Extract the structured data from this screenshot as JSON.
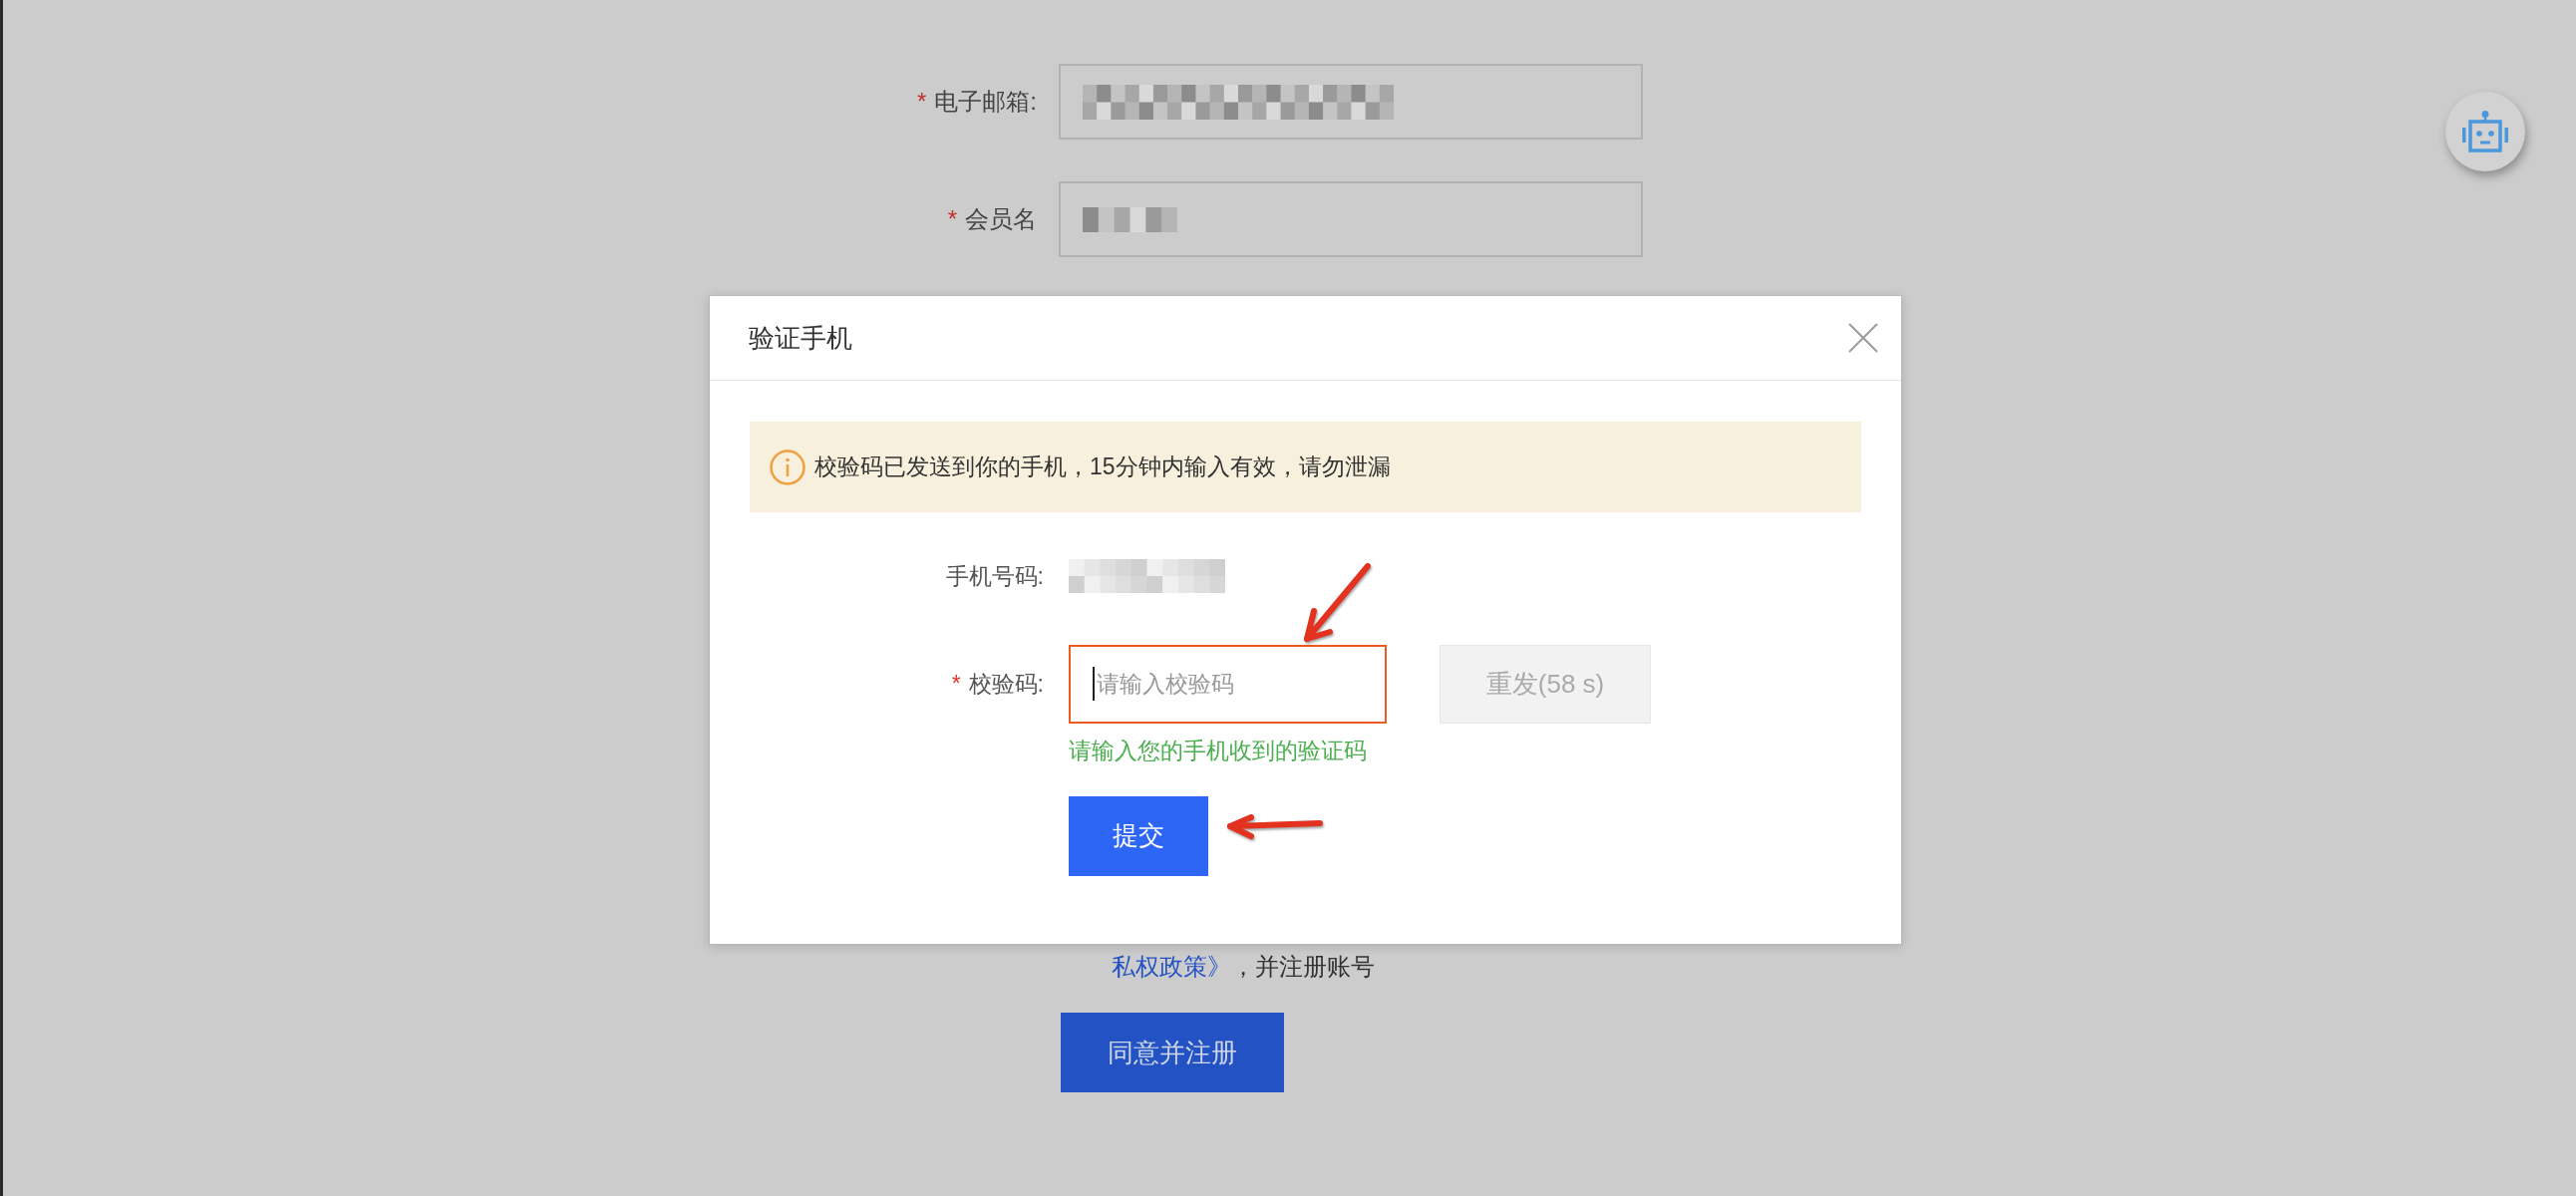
{
  "page": {
    "form": [
      {
        "mark": "*",
        "label": "电子邮箱:"
      },
      {
        "mark": "*",
        "label": "会员名"
      }
    ],
    "agreement": {
      "link": "私权政策》",
      "text": "，并注册账号"
    },
    "register_button": "同意并注册"
  },
  "dialog": {
    "title": "验证手机",
    "alert": "校验码已发送到你的手机，15分钟内输入有效，请勿泄漏",
    "phone": {
      "label": "手机号码:"
    },
    "code": {
      "mark": "*",
      "label": "校验码:",
      "placeholder": "请输入校验码",
      "focused": true,
      "hint": "请输入您的手机收到的验证码"
    },
    "resend_button": {
      "label": "重发(58 s)",
      "disabled": true
    },
    "submit_button": "提交"
  }
}
